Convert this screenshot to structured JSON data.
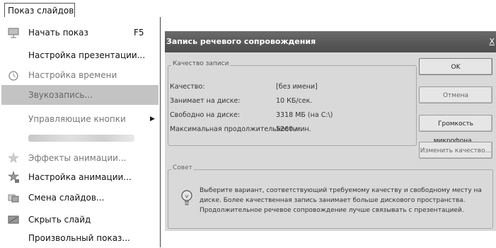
{
  "menu": {
    "title": "Показ слайдов",
    "items": [
      {
        "label": "Начать показ",
        "shortcut": "F5",
        "icon": "slideshow-icon",
        "state": "normal"
      },
      {
        "label": "Настройка презентации...",
        "icon": "",
        "state": "normal"
      },
      {
        "label": "Настройка времени",
        "icon": "rehearse-timings-icon",
        "state": "disabled"
      },
      {
        "label": "Звукозапись...",
        "icon": "",
        "state": "highlighted"
      },
      {
        "label": "Управляющие кнопки",
        "icon": "",
        "state": "disabled",
        "submenu": true
      },
      {
        "label": "",
        "icon": "",
        "state": "blurred"
      },
      {
        "label": "Эффекты анимации...",
        "icon": "animation-effects-icon",
        "state": "disabled"
      },
      {
        "label": "Настройка анимации...",
        "icon": "custom-animation-icon",
        "state": "normal"
      },
      {
        "label": "Смена слайдов...",
        "icon": "slide-transition-icon",
        "state": "normal"
      },
      {
        "label": "Скрыть слайд",
        "icon": "hide-slide-icon",
        "state": "normal"
      },
      {
        "label": "Произвольный показ...",
        "icon": "",
        "state": "normal"
      }
    ]
  },
  "dialog": {
    "title": "Запись речевого сопровождения",
    "close_label": "X",
    "quality_group": {
      "label": "Качество записи",
      "rows": [
        {
          "key": "Качество:",
          "value": "[без имени]"
        },
        {
          "key": "Занимает на диске:",
          "value": "10 КБ/сек."
        },
        {
          "key": "Свободно на диске:",
          "value": "3318 МБ (на C:\\)"
        },
        {
          "key": "Максимальная продолжительность:",
          "value": "5260 мин."
        }
      ]
    },
    "buttons": {
      "ok": "OK",
      "cancel": "Отмена",
      "mic_level": "Громкость микрофона...",
      "change_quality": "Изменить качество..."
    },
    "tip_group": {
      "label": "Совет",
      "text": "Выберите вариант, соответствующий требуемому качеству и свободному месту на диске. Более качественная запись занимает больше дискового пространства. Продолжительное речевое сопровождение лучше связывать с презентацией."
    }
  },
  "colors": {
    "dialog_bg": "#d9d9d9",
    "titlebar": "#5a5a5a",
    "menu_highlight": "#c3c3c3"
  }
}
